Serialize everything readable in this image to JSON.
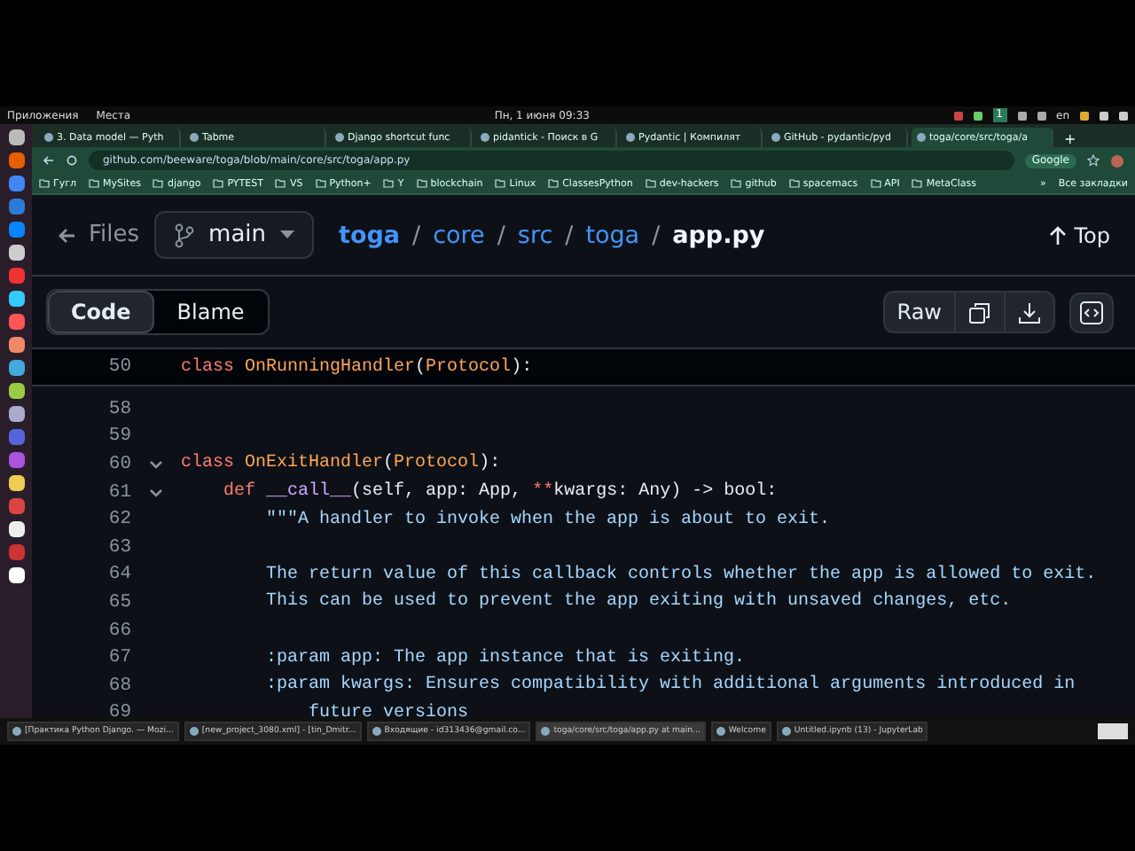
{
  "top_panel": {
    "menus": [
      "Приложения",
      "Места"
    ],
    "clock": "Пн, 1 июня 09:33",
    "workspace": "1",
    "layout": "en"
  },
  "browser": {
    "tabs": [
      {
        "label": "3. Data model — Pyth",
        "selected": false
      },
      {
        "label": "Tabme",
        "selected": false
      },
      {
        "label": "Django shortcut func",
        "selected": false
      },
      {
        "label": "pidantick - Поиск в G",
        "selected": false
      },
      {
        "label": "Pydantic | Компилят",
        "selected": false
      },
      {
        "label": "GitHub - pydantic/pyd",
        "selected": false
      },
      {
        "label": "toga/core/src/toga/a",
        "selected": true
      }
    ],
    "new_tab": "+",
    "address": "github.com/beeware/toga/blob/main/core/src/toga/app.py",
    "search_chip": "Google",
    "bookmarks": [
      "Гугл",
      "MySites",
      "django",
      "PYTEST",
      "VS",
      "Python+",
      "Y",
      "blockchain",
      "Linux",
      "ClassesPython",
      "dev-hackers",
      "github",
      "spacemacs",
      "API",
      "MetaClass"
    ],
    "bookmarks_more": "»",
    "all_bookmarks": "Все закладки"
  },
  "github": {
    "back_label": "Files",
    "branch": "main",
    "breadcrumb": [
      "toga",
      "core",
      "src",
      "toga"
    ],
    "separator": "/",
    "file": "app.py",
    "top": "Top",
    "view_tabs": [
      {
        "label": "Code",
        "selected": true
      },
      {
        "label": "Blame",
        "selected": false
      }
    ],
    "raw": "Raw",
    "sticky": {
      "number": "50",
      "tokens": [
        {
          "text": "class ",
          "kind": "kw"
        },
        {
          "text": "OnRunningHandler",
          "kind": "cls"
        },
        {
          "text": "(",
          "kind": "plain"
        },
        {
          "text": "Protocol",
          "kind": "cls"
        },
        {
          "text": "):",
          "kind": "plain"
        }
      ]
    },
    "lines": [
      {
        "number": "58",
        "foldable": false
      },
      {
        "number": "59",
        "foldable": false
      },
      {
        "number": "60",
        "foldable": true,
        "tokens": [
          {
            "text": "class ",
            "kind": "kw"
          },
          {
            "text": "OnExitHandler",
            "kind": "cls"
          },
          {
            "text": "(",
            "kind": "plain"
          },
          {
            "text": "Protocol",
            "kind": "cls"
          },
          {
            "text": "):",
            "kind": "plain"
          }
        ]
      },
      {
        "number": "61",
        "foldable": true,
        "tokens": [
          {
            "text": "    def ",
            "kind": "kw"
          },
          {
            "text": "__call__",
            "kind": "fn"
          },
          {
            "text": "(self, app: App, ",
            "kind": "plain"
          },
          {
            "text": "**",
            "kind": "kw"
          },
          {
            "text": "kwargs: Any) -> bool:",
            "kind": "plain"
          }
        ]
      },
      {
        "number": "62",
        "foldable": false,
        "tokens": [
          {
            "text": "        \"\"\"A handler to invoke when the app is about to exit.",
            "kind": "str"
          }
        ]
      },
      {
        "number": "63",
        "foldable": false
      },
      {
        "number": "64",
        "foldable": false,
        "tokens": [
          {
            "text": "        The return value of this callback controls whether the app is allowed to exit.",
            "kind": "str"
          }
        ]
      },
      {
        "number": "65",
        "foldable": false,
        "tokens": [
          {
            "text": "        This can be used to prevent the app exiting with unsaved changes, etc.",
            "kind": "str"
          }
        ]
      },
      {
        "number": "66",
        "foldable": false
      },
      {
        "number": "67",
        "foldable": false,
        "tokens": [
          {
            "text": "        :param app: The app instance that is exiting.",
            "kind": "str"
          }
        ]
      },
      {
        "number": "68",
        "foldable": false,
        "tokens": [
          {
            "text": "        :param kwargs: Ensures compatibility with additional arguments introduced in",
            "kind": "str"
          }
        ]
      },
      {
        "number": "69",
        "foldable": false,
        "tokens": [
          {
            "text": "            future versions",
            "kind": "str"
          }
        ]
      }
    ]
  },
  "taskbar": [
    {
      "label": "[Практика Python Django. — Mozi...",
      "selected": false
    },
    {
      "label": "[new_project_3080.xml] - [tin_Dmitr...",
      "selected": false
    },
    {
      "label": "Входящие - id313436@gmail.co...",
      "selected": false
    },
    {
      "label": "toga/core/src/toga/app.py at main...",
      "selected": true
    },
    {
      "label": "Welcome",
      "selected": false
    },
    {
      "label": "Untitled.ipynb (13) - JupyterLab",
      "selected": false
    }
  ]
}
